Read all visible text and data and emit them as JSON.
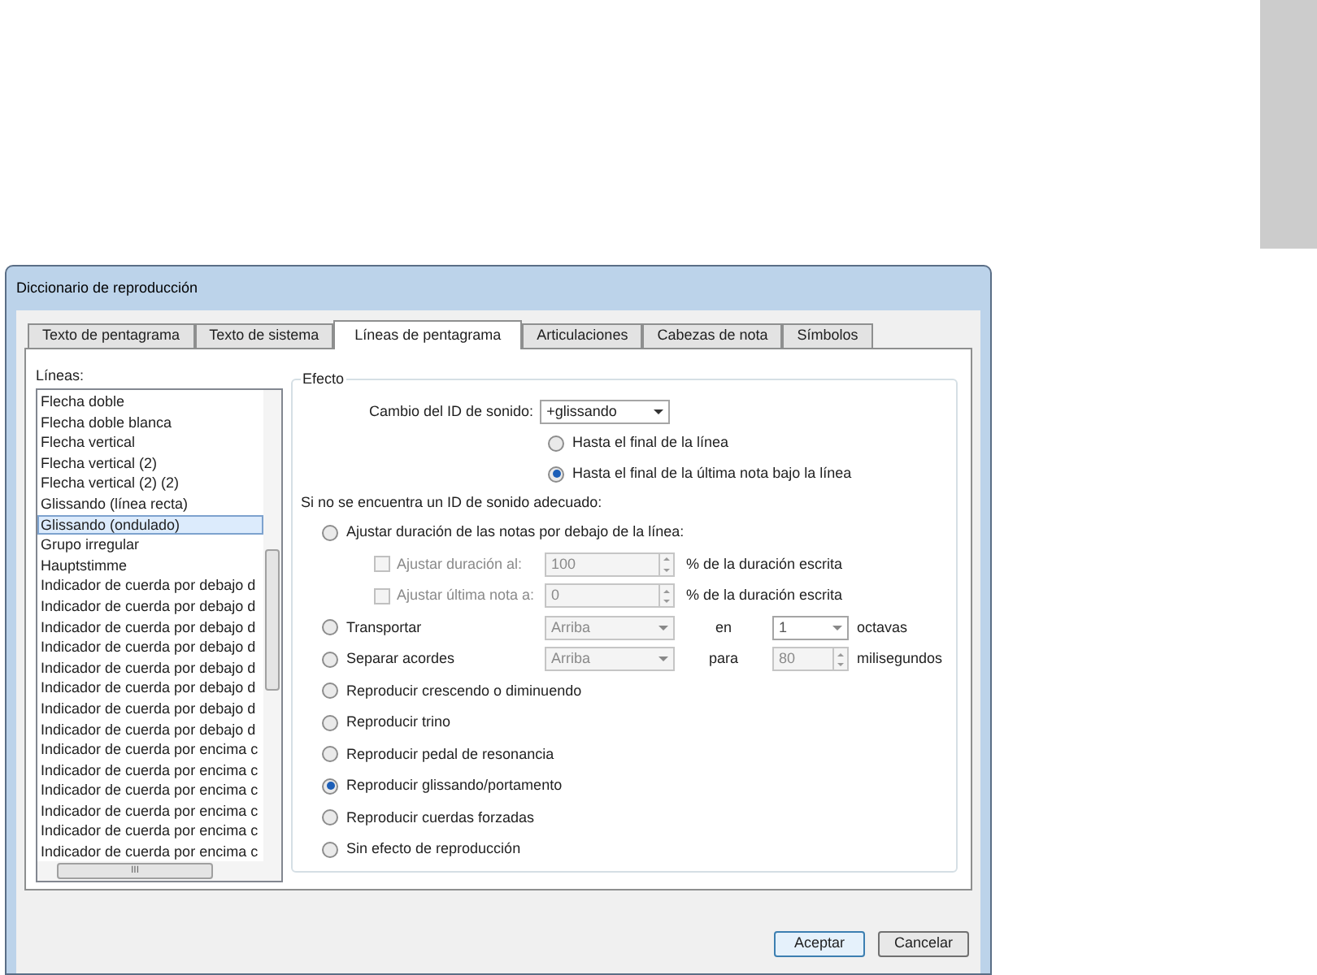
{
  "window": {
    "title": "Diccionario de reproducción"
  },
  "tabs": [
    {
      "label": "Texto de pentagrama",
      "selected": false
    },
    {
      "label": "Texto de sistema",
      "selected": false
    },
    {
      "label": "Líneas de pentagrama",
      "selected": true
    },
    {
      "label": "Articulaciones",
      "selected": false
    },
    {
      "label": "Cabezas de nota",
      "selected": false
    },
    {
      "label": "Símbolos",
      "selected": false
    }
  ],
  "lines": {
    "label": "Líneas:",
    "items": [
      {
        "label": "Flecha doble",
        "selected": false
      },
      {
        "label": "Flecha doble blanca",
        "selected": false
      },
      {
        "label": "Flecha vertical",
        "selected": false
      },
      {
        "label": "Flecha vertical (2)",
        "selected": false
      },
      {
        "label": "Flecha vertical (2) (2)",
        "selected": false
      },
      {
        "label": "Glissando (línea recta)",
        "selected": false
      },
      {
        "label": "Glissando (ondulado)",
        "selected": true
      },
      {
        "label": "Grupo irregular",
        "selected": false
      },
      {
        "label": "Hauptstimme",
        "selected": false
      },
      {
        "label": "Indicador de cuerda por debajo d",
        "selected": false
      },
      {
        "label": "Indicador de cuerda por debajo d",
        "selected": false
      },
      {
        "label": "Indicador de cuerda por debajo d",
        "selected": false
      },
      {
        "label": "Indicador de cuerda por debajo d",
        "selected": false
      },
      {
        "label": "Indicador de cuerda por debajo d",
        "selected": false
      },
      {
        "label": "Indicador de cuerda por debajo d",
        "selected": false
      },
      {
        "label": "Indicador de cuerda por debajo d",
        "selected": false
      },
      {
        "label": "Indicador de cuerda por debajo d",
        "selected": false
      },
      {
        "label": "Indicador de cuerda por encima c",
        "selected": false
      },
      {
        "label": "Indicador de cuerda por encima c",
        "selected": false
      },
      {
        "label": "Indicador de cuerda por encima c",
        "selected": false
      },
      {
        "label": "Indicador de cuerda por encima c",
        "selected": false
      },
      {
        "label": "Indicador de cuerda por encima c",
        "selected": false
      },
      {
        "label": "Indicador de cuerda por encima c",
        "selected": false
      }
    ],
    "scrollbar_thumb": "III"
  },
  "effect": {
    "title": "Efecto",
    "sound_id_label": "Cambio del ID de sonido:",
    "sound_id_value": "+glissando",
    "scope": [
      {
        "label": "Hasta el final de la línea",
        "selected": false
      },
      {
        "label": "Hasta el final de la última nota bajo la línea",
        "selected": true
      }
    ],
    "fallback_label": "Si no se encuentra un ID de sonido adecuado:",
    "options": [
      {
        "label": "Ajustar duración de las notas por debajo de la línea:",
        "selected": false,
        "sub": [
          {
            "label": "Ajustar duración al:",
            "checked": false,
            "disabled": true,
            "value": "100",
            "suffix": "% de la duración escrita"
          },
          {
            "label": "Ajustar última nota a:",
            "checked": false,
            "disabled": true,
            "value": "0",
            "suffix": "% de la duración escrita"
          }
        ]
      },
      {
        "label": "Transportar",
        "selected": false,
        "controls": [
          {
            "kind": "dropdown",
            "value": "Arriba",
            "disabled": true
          },
          {
            "kind": "text",
            "value": "en"
          },
          {
            "kind": "dropdown",
            "value": "1",
            "disabled": false
          },
          {
            "kind": "text",
            "value": "octavas"
          }
        ]
      },
      {
        "label": "Separar acordes",
        "selected": false,
        "controls": [
          {
            "kind": "dropdown",
            "value": "Arriba",
            "disabled": true
          },
          {
            "kind": "text",
            "value": "para"
          },
          {
            "kind": "spinner",
            "value": "80",
            "disabled": true
          },
          {
            "kind": "text",
            "value": "milisegundos"
          }
        ]
      },
      {
        "label": "Reproducir crescendo o diminuendo",
        "selected": false
      },
      {
        "label": "Reproducir trino",
        "selected": false
      },
      {
        "label": "Reproducir pedal de resonancia",
        "selected": false
      },
      {
        "label": "Reproducir glissando/portamento",
        "selected": true
      },
      {
        "label": "Reproducir cuerdas forzadas",
        "selected": false
      },
      {
        "label": "Sin efecto de reproducción",
        "selected": false
      }
    ]
  },
  "buttons": [
    {
      "label": "Aceptar",
      "default": true
    },
    {
      "label": "Cancelar",
      "default": false
    }
  ]
}
